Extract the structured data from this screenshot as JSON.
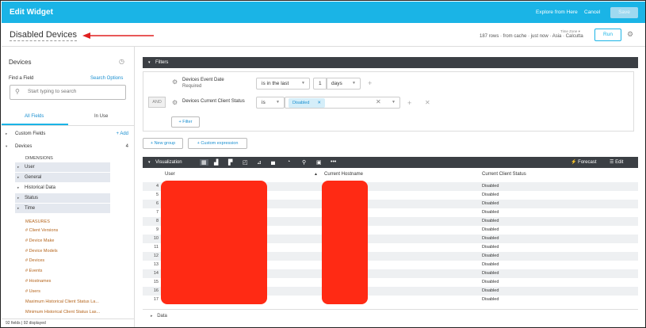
{
  "topbar": {
    "title": "Edit Widget",
    "explore": "Explore from Here",
    "cancel": "Cancel",
    "save": "Save"
  },
  "header": {
    "widget_name": "Disabled Devices",
    "timezone_label": "Time Zone ▾",
    "meta": "187 rows · from cache · just now · Asia · Calcutta",
    "run": "Run"
  },
  "left": {
    "title": "Devices",
    "find_field": "Find a Field",
    "search_options": "Search Options",
    "search_placeholder": "Start typing to search",
    "tabs": [
      "All Fields",
      "In Use"
    ],
    "custom_fields": "Custom Fields",
    "custom_add": "+ Add",
    "devices": "Devices",
    "devices_count": "4",
    "dimensions_label": "DIMENSIONS",
    "dimensions": [
      "User",
      "General",
      "Historical Data",
      "Status",
      "Time"
    ],
    "measures_label": "MEASURES",
    "measures": [
      "# Client Versions",
      "# Device Make",
      "# Device Models",
      "# Devices",
      "# Events",
      "# Hostnames",
      "# Users",
      "Maximum Historical Client Status La...",
      "Minimum Historical Client Status Las..."
    ],
    "footer": "92 fields | 92 displayed"
  },
  "filters": {
    "bar_label": "Filters",
    "f1_label": "Devices Event Date",
    "f1_sub": "Required",
    "f1_op": "is in the last",
    "f1_num": "1",
    "f1_unit": "days",
    "and": "AND",
    "f2_label": "Devices Current Client Status",
    "f2_op": "is",
    "f2_chip": "Disabled",
    "add_filter": "+ Filter",
    "new_group": "+ New group",
    "custom_expr": "+ Custom expression"
  },
  "viz": {
    "bar_label": "Visualization",
    "more": "•••",
    "forecast": "Forecast",
    "edit": "Edit"
  },
  "table": {
    "headers": [
      "User",
      "Current Hostname",
      "Current Client Status"
    ],
    "rows": [
      {
        "n": "4",
        "s": "Disabled"
      },
      {
        "n": "5",
        "s": "Disabled"
      },
      {
        "n": "6",
        "s": "Disabled"
      },
      {
        "n": "7",
        "s": "Disabled"
      },
      {
        "n": "8",
        "s": "Disabled"
      },
      {
        "n": "9",
        "s": "Disabled"
      },
      {
        "n": "10",
        "s": "Disabled"
      },
      {
        "n": "11",
        "s": "Disabled"
      },
      {
        "n": "12",
        "s": "Disabled"
      },
      {
        "n": "13",
        "s": "Disabled"
      },
      {
        "n": "14",
        "s": "Disabled"
      },
      {
        "n": "15",
        "s": "Disabled"
      },
      {
        "n": "16",
        "s": "Disabled"
      },
      {
        "n": "17",
        "s": "Disabled"
      }
    ]
  },
  "data_section": "Data",
  "colors": {
    "accent": "#1ab4e6",
    "bar": "#3b3f44",
    "redaction": "#ff2a14",
    "measure": "#b5651d"
  }
}
